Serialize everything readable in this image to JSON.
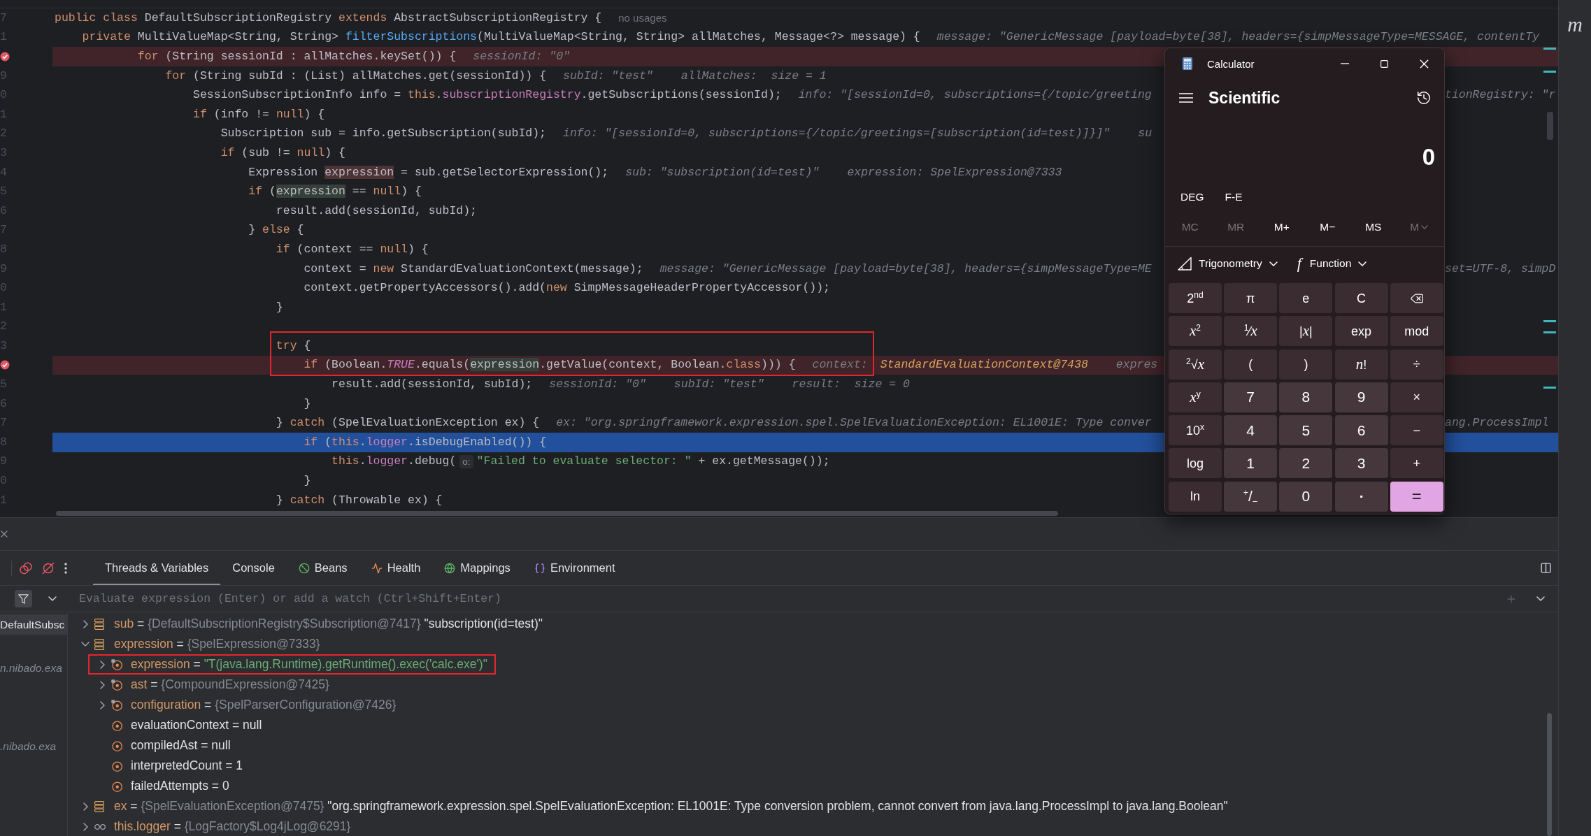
{
  "editor": {
    "lines": [
      {
        "number": "7",
        "breakpoint": false,
        "current": false,
        "framed": false,
        "tokens": [
          {
            "kind": "keyword",
            "text": "public class "
          },
          {
            "kind": "plain",
            "text": "DefaultSubscriptionRegistry "
          },
          {
            "kind": "keyword",
            "text": "extends "
          },
          {
            "kind": "plain",
            "text": "AbstractSubscriptionRegistry {"
          }
        ],
        "note": "no usages"
      },
      {
        "number": "1",
        "breakpoint": false,
        "current": false,
        "framed": false,
        "tokens": [
          {
            "kind": "keyword",
            "text": "    private "
          },
          {
            "kind": "plain",
            "text": "MultiValueMap<String, String> "
          },
          {
            "kind": "method",
            "text": "filterSubscriptions"
          },
          {
            "kind": "plain",
            "text": "(MultiValueMap<String, String> allMatches, Message<?> message) {"
          }
        ],
        "hints": [
          {
            "text": "message: \"GenericMessage [payload=byte[38], headers={simpMessageType=MESSAGE, contentTy",
            "changed": false
          }
        ]
      },
      {
        "breakpoint": true,
        "current": false,
        "framed": false,
        "tokens": [
          {
            "kind": "keyword",
            "text": "            for "
          },
          {
            "kind": "plain",
            "text": "(String sessionId : allMatches.keySet()) {"
          }
        ],
        "hints": [
          {
            "text": "sessionId: \"0\"",
            "changed": false
          }
        ]
      },
      {
        "number": "9",
        "breakpoint": false,
        "current": false,
        "framed": false,
        "tokens": [
          {
            "kind": "keyword",
            "text": "                for "
          },
          {
            "kind": "plain",
            "text": "(String subId : (List) allMatches.get(sessionId)) {"
          }
        ],
        "hints": [
          {
            "text": "subId: \"test\"",
            "changed": false
          },
          {
            "text": "allMatches:  size = 1",
            "changed": false
          }
        ]
      },
      {
        "number": "0",
        "breakpoint": false,
        "current": false,
        "framed": false,
        "tokens": [
          {
            "kind": "plain",
            "text": "                    SessionSubscriptionInfo info = "
          },
          {
            "kind": "keyword",
            "text": "this"
          },
          {
            "kind": "plain",
            "text": "."
          },
          {
            "kind": "field",
            "text": "subscriptionRegistry"
          },
          {
            "kind": "plain",
            "text": ".getSubscriptions(sessionId);"
          }
        ],
        "hints": [
          {
            "text": "info: \"[sessionId=0, subscriptions={/topic/greeting",
            "changed": false
          }
        ],
        "tail": "tionRegistry: \"r"
      },
      {
        "number": "1",
        "breakpoint": false,
        "current": false,
        "framed": false,
        "tokens": [
          {
            "kind": "keyword",
            "text": "                    if "
          },
          {
            "kind": "plain",
            "text": "(info != "
          },
          {
            "kind": "keyword",
            "text": "null"
          },
          {
            "kind": "plain",
            "text": ") {"
          }
        ]
      },
      {
        "number": "2",
        "breakpoint": false,
        "current": false,
        "framed": false,
        "tokens": [
          {
            "kind": "plain",
            "text": "                        Subscription sub = info.getSubscription(subId);"
          }
        ],
        "hints": [
          {
            "text": "info: \"[sessionId=0, subscriptions={/topic/greetings=[subscription(id=test)]}]\"",
            "changed": false
          },
          {
            "text": "su",
            "changed": false
          }
        ]
      },
      {
        "number": "3",
        "breakpoint": false,
        "current": false,
        "framed": false,
        "tokens": [
          {
            "kind": "keyword",
            "text": "                        if "
          },
          {
            "kind": "plain",
            "text": "(sub != "
          },
          {
            "kind": "keyword",
            "text": "null"
          },
          {
            "kind": "plain",
            "text": ") {"
          }
        ]
      },
      {
        "number": "4",
        "breakpoint": false,
        "current": false,
        "framed": false,
        "tokens": [
          {
            "kind": "plain",
            "text": "                            Expression "
          },
          {
            "kind": "write",
            "text": "expression"
          },
          {
            "kind": "plain",
            "text": " = sub.getSelectorExpression();"
          }
        ],
        "hints": [
          {
            "text": "sub: \"subscription(id=test)\"",
            "changed": false
          },
          {
            "text": "expression: SpelExpression@7333",
            "changed": false
          }
        ]
      },
      {
        "number": "5",
        "breakpoint": false,
        "current": false,
        "framed": false,
        "tokens": [
          {
            "kind": "keyword",
            "text": "                            if "
          },
          {
            "kind": "plain",
            "text": "("
          },
          {
            "kind": "read",
            "text": "expression"
          },
          {
            "kind": "plain",
            "text": " == "
          },
          {
            "kind": "keyword",
            "text": "null"
          },
          {
            "kind": "plain",
            "text": ") {"
          }
        ]
      },
      {
        "number": "6",
        "breakpoint": false,
        "current": false,
        "framed": false,
        "tokens": [
          {
            "kind": "plain",
            "text": "                                result.add(sessionId, subId);"
          }
        ]
      },
      {
        "number": "7",
        "breakpoint": false,
        "current": false,
        "framed": false,
        "tokens": [
          {
            "kind": "plain",
            "text": "                            } "
          },
          {
            "kind": "keyword",
            "text": "else"
          },
          {
            "kind": "plain",
            "text": " {"
          }
        ]
      },
      {
        "number": "8",
        "breakpoint": false,
        "current": false,
        "framed": false,
        "tokens": [
          {
            "kind": "keyword",
            "text": "                                if "
          },
          {
            "kind": "plain",
            "text": "(context == "
          },
          {
            "kind": "keyword",
            "text": "null"
          },
          {
            "kind": "plain",
            "text": ") {"
          }
        ]
      },
      {
        "number": "9",
        "breakpoint": false,
        "current": false,
        "framed": false,
        "tokens": [
          {
            "kind": "plain",
            "text": "                                    context = "
          },
          {
            "kind": "keyword",
            "text": "new"
          },
          {
            "kind": "plain",
            "text": " StandardEvaluationContext(message);"
          }
        ],
        "hints": [
          {
            "text": "message: \"GenericMessage [payload=byte[38], headers={simpMessageType=ME",
            "changed": false
          }
        ],
        "tail": "set=UTF-8, simpD"
      },
      {
        "number": "0",
        "breakpoint": false,
        "current": false,
        "framed": false,
        "tokens": [
          {
            "kind": "plain",
            "text": "                                    context.getPropertyAccessors().add("
          },
          {
            "kind": "keyword",
            "text": "new"
          },
          {
            "kind": "plain",
            "text": " SimpMessageHeaderPropertyAccessor());"
          }
        ]
      },
      {
        "number": "1",
        "breakpoint": false,
        "current": false,
        "framed": false,
        "tokens": [
          {
            "kind": "plain",
            "text": "                                }"
          }
        ]
      },
      {
        "number": "2",
        "breakpoint": false,
        "current": false,
        "framed": false
      },
      {
        "number": "3",
        "breakpoint": false,
        "current": false,
        "framed": true,
        "tokens": [
          {
            "kind": "keyword",
            "text": "                                try"
          },
          {
            "kind": "plain",
            "text": " {"
          }
        ]
      },
      {
        "breakpoint": true,
        "current": false,
        "framed": true,
        "tokens": [
          {
            "kind": "keyword",
            "text": "                                    if "
          },
          {
            "kind": "plain",
            "text": "(Boolean."
          },
          {
            "kind": "constant",
            "text": "TRUE"
          },
          {
            "kind": "plain",
            "text": ".equals("
          },
          {
            "kind": "read",
            "text": "expression"
          },
          {
            "kind": "plain",
            "text": ".getValue(context, Boolean."
          },
          {
            "kind": "keyword",
            "text": "class"
          },
          {
            "kind": "plain",
            "text": "))) {"
          }
        ],
        "hints": [
          {
            "text": "context:",
            "value": "StandardEvaluationContext@7438",
            "changed": true
          },
          {
            "text": "expres",
            "changed": false
          }
        ]
      },
      {
        "number": "5",
        "breakpoint": false,
        "current": false,
        "framed": false,
        "tokens": [
          {
            "kind": "plain",
            "text": "                                        result.add(sessionId, subId);"
          }
        ],
        "hints": [
          {
            "text": "sessionId: \"0\"",
            "changed": false
          },
          {
            "text": "subId: \"test\"",
            "changed": false
          },
          {
            "text": "result:  size = 0",
            "changed": false
          }
        ]
      },
      {
        "number": "6",
        "breakpoint": false,
        "current": false,
        "framed": false,
        "tokens": [
          {
            "kind": "plain",
            "text": "                                    }"
          }
        ]
      },
      {
        "number": "7",
        "breakpoint": false,
        "current": false,
        "framed": false,
        "tokens": [
          {
            "kind": "plain",
            "text": "                                } "
          },
          {
            "kind": "keyword",
            "text": "catch"
          },
          {
            "kind": "plain",
            "text": " (SpelEvaluationException ex) {"
          }
        ],
        "hints": [
          {
            "text": "ex: \"org.springframework.expression.spel.SpelEvaluationException: EL1001E: Type conver",
            "changed": false
          }
        ],
        "tail": "ang.ProcessImpl"
      },
      {
        "number": "8",
        "breakpoint": false,
        "current": true,
        "framed": false,
        "tokens": [
          {
            "kind": "keyword",
            "text": "                                    if "
          },
          {
            "kind": "plain",
            "text": "("
          },
          {
            "kind": "keyword",
            "text": "this"
          },
          {
            "kind": "plain",
            "text": "."
          },
          {
            "kind": "field",
            "text": "logger"
          },
          {
            "kind": "plain",
            "text": ".isDebugEnabled()) {"
          }
        ]
      },
      {
        "number": "9",
        "breakpoint": false,
        "current": false,
        "framed": false,
        "tokens": [
          {
            "kind": "keyword",
            "text": "                                        this"
          },
          {
            "kind": "plain",
            "text": "."
          },
          {
            "kind": "field",
            "text": "logger"
          },
          {
            "kind": "plain",
            "text": ".debug("
          },
          {
            "kind": "param_hint",
            "text": "o:"
          },
          {
            "kind": "string",
            "text": "\"Failed to evaluate selector: \""
          },
          {
            "kind": "plain",
            "text": " + ex.getMessage());"
          }
        ]
      },
      {
        "number": "0",
        "breakpoint": false,
        "current": false,
        "framed": false,
        "tokens": [
          {
            "kind": "plain",
            "text": "                                    }"
          }
        ]
      },
      {
        "number": "1",
        "breakpoint": false,
        "current": false,
        "framed": false,
        "tokens": [
          {
            "kind": "plain",
            "text": "                                } "
          },
          {
            "kind": "keyword",
            "text": "catch"
          },
          {
            "kind": "plain",
            "text": " (Throwable ex) {"
          }
        ]
      }
    ]
  },
  "debugger": {
    "tabs": [
      {
        "label": "Threads & Variables",
        "selected": true,
        "kind": "text"
      },
      {
        "label": "Console",
        "selected": false,
        "kind": "text"
      },
      {
        "label": "Beans",
        "selected": false,
        "kind": "beans"
      },
      {
        "label": "Health",
        "selected": false,
        "kind": "health"
      },
      {
        "label": "Mappings",
        "selected": false,
        "kind": "mappings"
      },
      {
        "label": "Environment",
        "selected": false,
        "kind": "environment"
      }
    ],
    "filter": {
      "on": true
    },
    "evaluate": {
      "placeholder": "Evaluate expression (Enter) or add a watch (Ctrl+Shift+Enter)"
    },
    "frames": [
      {
        "label": "DefaultSubsc",
        "selected": true,
        "library": false
      },
      {
        "label": "n.nibado.exa",
        "selected": false,
        "library": true
      },
      {
        "label": ".nibado.exa",
        "selected": false,
        "library": true
      }
    ],
    "variables": [
      {
        "name": "sub",
        "sep": "=",
        "kind": "local",
        "expanded": false,
        "framed": false,
        "type": "{DefaultSubscriptionRegistry$Subscription@7417}",
        "value": "\"subscription(id=test)\"",
        "string": false
      },
      {
        "name": "expression",
        "sep": "=",
        "kind": "local",
        "expanded": true,
        "framed": false,
        "type": "{SpelExpression@7333}",
        "children": [
          {
            "name": "expression",
            "sep": "=",
            "kind": "final_field",
            "expanded": false,
            "framed": true,
            "value": "\"T(java.lang.Runtime).getRuntime().exec('calc.exe')\"",
            "string": true
          },
          {
            "name": "ast",
            "sep": "=",
            "kind": "final_field",
            "expanded": false,
            "framed": false,
            "type": "{CompoundExpression@7425}"
          },
          {
            "name": "configuration",
            "sep": "=",
            "kind": "final_field",
            "expanded": false,
            "framed": false,
            "type": "{SpelParserConfiguration@7426}"
          },
          {
            "name": "evaluationContext",
            "sep": "=",
            "kind": "field",
            "framed": false,
            "value": "null",
            "string": false
          },
          {
            "name": "compiledAst",
            "sep": "=",
            "kind": "field",
            "framed": false,
            "value": "null",
            "string": false
          },
          {
            "name": "interpretedCount",
            "sep": "=",
            "kind": "field",
            "framed": false,
            "value": "1",
            "string": false
          },
          {
            "name": "failedAttempts",
            "sep": "=",
            "kind": "field",
            "framed": false,
            "value": "0",
            "string": false
          }
        ]
      },
      {
        "name": "ex",
        "sep": "=",
        "kind": "local",
        "expanded": false,
        "framed": false,
        "type": "{SpelEvaluationException@7475}",
        "value": "\"org.springframework.expression.spel.SpelEvaluationException: EL1001E: Type conversion problem, cannot convert from java.lang.ProcessImpl to java.lang.Boolean\"",
        "string": false
      },
      {
        "name": "this.logger",
        "sep": "=",
        "kind": "watch",
        "expanded": false,
        "framed": false,
        "type": "{LogFactory$Log4jLog@6291}"
      }
    ]
  },
  "calculator": {
    "title": "Calculator",
    "mode": "Scientific",
    "display": "0",
    "angle_unit": "DEG",
    "notation": "F-E",
    "memory": [
      {
        "label": "MC",
        "disabled": true,
        "kind": "plain"
      },
      {
        "label": "MR",
        "disabled": true,
        "kind": "plain"
      },
      {
        "label": "M+",
        "disabled": false,
        "kind": "plain"
      },
      {
        "label": "M−",
        "disabled": false,
        "kind": "plain"
      },
      {
        "label": "MS",
        "disabled": false,
        "kind": "plain"
      },
      {
        "label": "M",
        "disabled": true,
        "kind": "dropdown"
      }
    ],
    "menus": [
      {
        "label": "Trigonometry",
        "kind": "trigonometry"
      },
      {
        "label": "Function",
        "kind": "function",
        "glyph": "f"
      }
    ],
    "keys": [
      {
        "label": "2$^{nd}$",
        "kind": "function"
      },
      {
        "label": "π",
        "kind": "function"
      },
      {
        "label": "e",
        "kind": "function"
      },
      {
        "label": "C",
        "kind": "function"
      },
      {
        "kind": "backspace"
      },
      {
        "label": "*x*$^{2}$",
        "kind": "function"
      },
      {
        "label": "$^{1}$⁄*x*",
        "kind": "function"
      },
      {
        "label": "|*x*|",
        "kind": "function"
      },
      {
        "label": "exp",
        "kind": "function"
      },
      {
        "label": "mod",
        "kind": "function"
      },
      {
        "label": "$^{2}$√*x*",
        "kind": "function"
      },
      {
        "label": "(",
        "kind": "function"
      },
      {
        "label": ")",
        "kind": "function"
      },
      {
        "label": "*n*!",
        "kind": "function"
      },
      {
        "label": "÷",
        "kind": "function"
      },
      {
        "label": "*x*$^{y}$",
        "kind": "function"
      },
      {
        "label": "7",
        "kind": "digit"
      },
      {
        "label": "8",
        "kind": "digit"
      },
      {
        "label": "9",
        "kind": "digit"
      },
      {
        "label": "×",
        "kind": "function"
      },
      {
        "label": "10$^{x}$",
        "kind": "function"
      },
      {
        "label": "4",
        "kind": "digit"
      },
      {
        "label": "5",
        "kind": "digit"
      },
      {
        "label": "6",
        "kind": "digit"
      },
      {
        "label": "−",
        "kind": "function"
      },
      {
        "label": "log",
        "kind": "function"
      },
      {
        "label": "1",
        "kind": "digit"
      },
      {
        "label": "2",
        "kind": "digit"
      },
      {
        "label": "3",
        "kind": "digit"
      },
      {
        "label": "+",
        "kind": "function"
      },
      {
        "label": "ln",
        "kind": "function"
      },
      {
        "label": "$^{+}$/$_{−}$",
        "kind": "digit"
      },
      {
        "label": "0",
        "kind": "digit"
      },
      {
        "label": ".",
        "kind": "point"
      },
      {
        "label": "=",
        "kind": "equals"
      }
    ]
  },
  "side_strip": {
    "label": "m"
  }
}
